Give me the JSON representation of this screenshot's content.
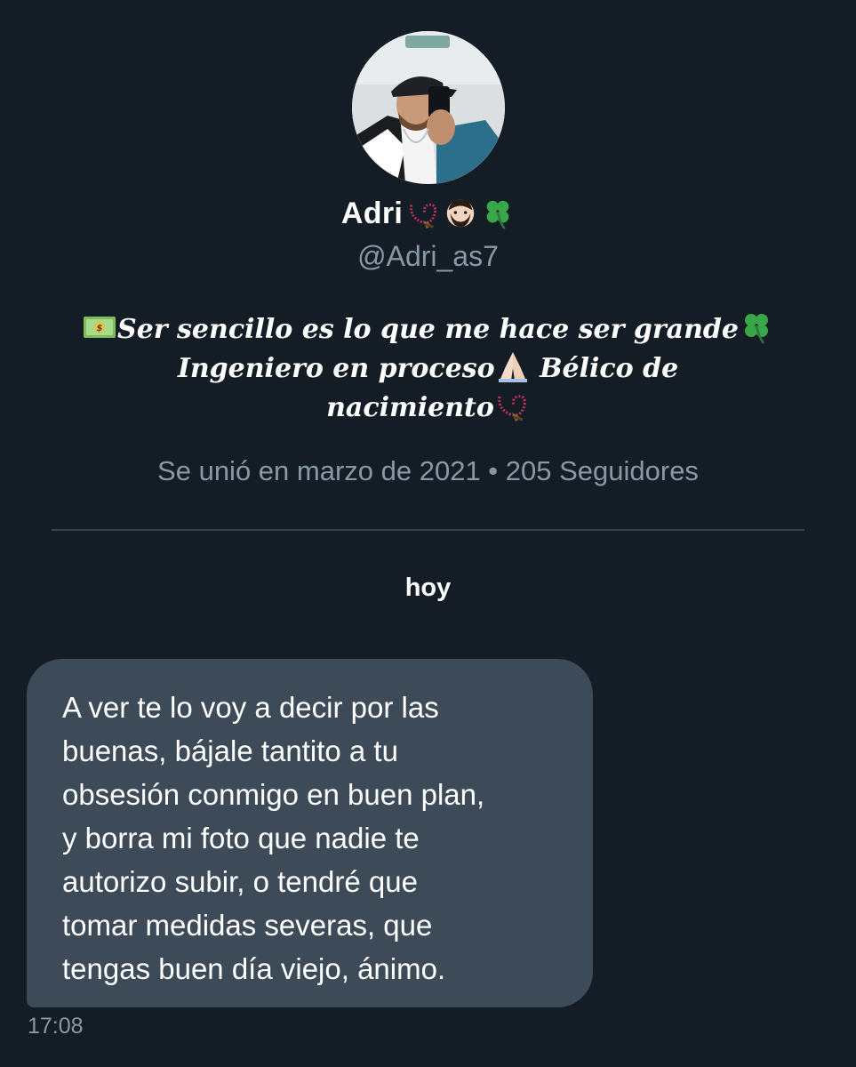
{
  "profile": {
    "display_name": "Adri",
    "name_emojis": [
      "prayer-beads",
      "man-beard",
      "four-leaf-clover"
    ],
    "handle": "@Adri_as7",
    "bio": {
      "line1": "Ser sencillo es lo que me hace ser grande",
      "line2_a": "Ingeniero en proceso",
      "line2_b": " Bélico de",
      "line3": "nacimiento"
    },
    "joined_text": "Se unió en marzo de 2021 • 205 Seguidores"
  },
  "conversation": {
    "day_label": "hoy",
    "message": {
      "text": "A ver te lo voy a decir por las\nbuenas, bájale tantito a tu\nobsesión conmigo en buen plan,\ny borra mi foto que nadie te\nautorizo subir, o tendré que\ntomar medidas severas, que\ntengas buen día viejo, ánimo.",
      "time": "17:08"
    }
  },
  "colors": {
    "background": "#141d26",
    "bubble": "#3d4a58",
    "secondary_text": "#8899a6",
    "divider": "#38444d"
  },
  "icons": [
    "money-emoji",
    "four-leaf-clover-emoji",
    "folded-hands-emoji",
    "prayer-beads-emoji",
    "man-beard-emoji"
  ]
}
